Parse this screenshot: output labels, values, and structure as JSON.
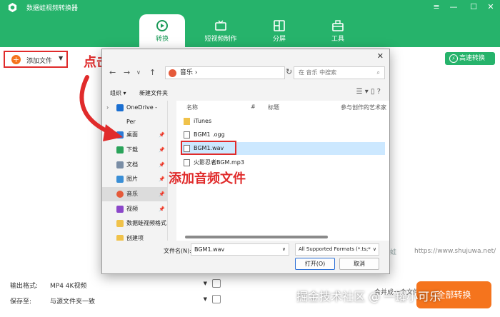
{
  "app": {
    "title": "数据蛙视频转换器"
  },
  "window_controls": [
    "≡",
    "—",
    "☐",
    "✕"
  ],
  "nav_tabs": [
    {
      "label": "转换",
      "icon": "convert-icon",
      "active": true
    },
    {
      "label": "短视频制作",
      "icon": "tv-icon",
      "active": false
    },
    {
      "label": "分屏",
      "icon": "split-screen-icon",
      "active": false
    },
    {
      "label": "工具",
      "icon": "toolbox-icon",
      "active": false
    }
  ],
  "toolbar": {
    "add_file": "添加文件",
    "fast_convert": "高速转换"
  },
  "annotations": {
    "click_add": "点击【添加文件】",
    "add_audio": "添加音频文件"
  },
  "bottom": {
    "format_label": "输出格式:",
    "format_value": "MP4 4K视频",
    "save_label": "保存至:",
    "save_value": "与源文件夹一致",
    "merge_label": "合并成一个文件",
    "start_button": "全部转换"
  },
  "watermarks": {
    "brand": "数据蛙",
    "url": "https://www.shujuwa.net/",
    "juejin": "掘金技术社区 @ 一罐小可乐"
  },
  "dialog": {
    "path": [
      "音乐"
    ],
    "search_placeholder": "在 音乐 中搜索",
    "organize": "组织 ▾",
    "new_folder": "新建文件夹",
    "columns": [
      "名称",
      "#",
      "标题",
      "参与创作的艺术家"
    ],
    "tree": [
      {
        "label": "OneDrive - Per",
        "icon": "onedrive-icon"
      },
      {
        "label": "桌面",
        "icon": "desktop-icon"
      },
      {
        "label": "下载",
        "icon": "download-icon"
      },
      {
        "label": "文档",
        "icon": "document-icon"
      },
      {
        "label": "图片",
        "icon": "picture-icon"
      },
      {
        "label": "音乐",
        "icon": "music-icon"
      },
      {
        "label": "视频",
        "icon": "video-icon"
      },
      {
        "label": "数据蛙视频格式",
        "icon": "folder-icon"
      },
      {
        "label": "创建项",
        "icon": "folder-icon"
      }
    ],
    "files": [
      {
        "name": "iTunes",
        "type": "folder"
      },
      {
        "name": "BGM1 .ogg",
        "type": "audio"
      },
      {
        "name": "BGM1.wav",
        "type": "audio",
        "selected": true
      },
      {
        "name": "火影忍者BGM.mp3",
        "type": "audio"
      }
    ],
    "filename_label": "文件名(N):",
    "filename_value": "BGM1.wav",
    "filter_value": "All Supported Formats (*.ts;*",
    "open_button": "打开(O)",
    "cancel_button": "取消"
  },
  "colors": {
    "brand_green": "#26b36b",
    "accent_orange": "#f5741d",
    "annotation_red": "#e02b2b"
  }
}
